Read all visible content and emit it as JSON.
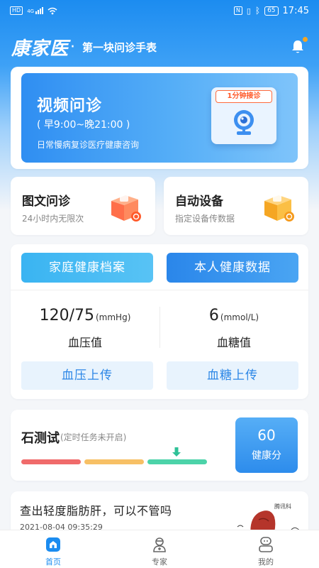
{
  "status_bar": {
    "left_chip": "HD",
    "signal_label": "4G",
    "battery": "65",
    "time": "17:45"
  },
  "header": {
    "logo": "康家医",
    "slogan": "第一块问诊手表"
  },
  "video_consult": {
    "title": "视频问诊",
    "hours": "( 早9:00~晚21:00 )",
    "description": "日常慢病复诊医疗健康咨询",
    "badge": "1分钟接诊"
  },
  "features": [
    {
      "title": "图文问诊",
      "subtitle": "24小时内无限次"
    },
    {
      "title": "自动设备",
      "subtitle": "指定设备传数据"
    }
  ],
  "health": {
    "family_button": "家庭健康档案",
    "personal_button": "本人健康数据",
    "blood_pressure": {
      "value": "120/75",
      "unit": "(mmHg)",
      "label": "血压值",
      "upload": "血压上传"
    },
    "blood_sugar": {
      "value": "6",
      "unit": "(mmol/L)",
      "label": "血糖值",
      "upload": "血糖上传"
    }
  },
  "stone_test": {
    "title": "石测试",
    "subtitle": "(定时任务未开启)",
    "score_value": "60",
    "score_label": "健康分",
    "colors": [
      "#f06b6b",
      "#f7c065",
      "#4cd3a9"
    ]
  },
  "news": {
    "title": "查出轻度脂肪肝，可以不管吗",
    "date": "2021-08-04 09:35:29",
    "image_caption": "腾讯科"
  },
  "tabs": [
    {
      "label": "首页",
      "icon": "home-icon",
      "active": true
    },
    {
      "label": "专家",
      "icon": "doctor-icon",
      "active": false
    },
    {
      "label": "我的",
      "icon": "profile-icon",
      "active": false
    }
  ],
  "colors": {
    "accent": "#1b8cf0",
    "score_bg": "#2d8cec"
  }
}
